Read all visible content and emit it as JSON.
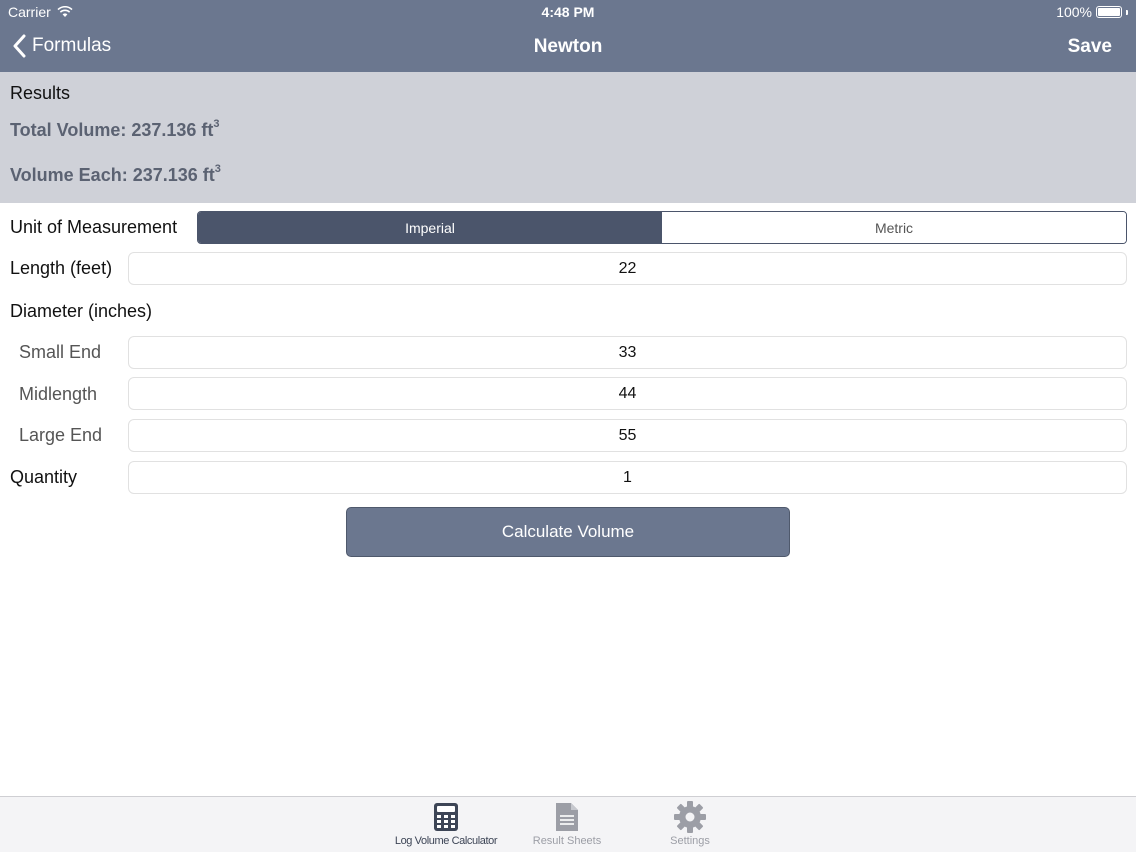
{
  "status_bar": {
    "carrier": "Carrier",
    "time": "4:48 PM",
    "battery": "100%"
  },
  "nav": {
    "back_label": "Formulas",
    "title": "Newton",
    "save_label": "Save"
  },
  "results": {
    "heading": "Results",
    "total_volume": "Total Volume: 237.136 ft",
    "volume_each": "Volume Each: 237.136 ft",
    "unit_exponent": "3"
  },
  "form": {
    "unit_label": "Unit of Measurement",
    "unit_options": [
      "Imperial",
      "Metric"
    ],
    "unit_selected": "Imperial",
    "length_label": "Length (feet)",
    "length_value": "22",
    "diameter_label": "Diameter (inches)",
    "small_end_label": "Small End",
    "small_end_value": "33",
    "midlength_label": "Midlength",
    "midlength_value": "44",
    "large_end_label": "Large End",
    "large_end_value": "55",
    "quantity_label": "Quantity",
    "quantity_value": "1",
    "calculate_label": "Calculate Volume"
  },
  "tabbar": {
    "tabs": [
      {
        "label": "Log Volume Calculator",
        "icon": "calculator-icon",
        "active": true
      },
      {
        "label": "Result Sheets",
        "icon": "document-icon",
        "active": false
      },
      {
        "label": "Settings",
        "icon": "gear-icon",
        "active": false
      }
    ]
  },
  "colors": {
    "nav_bar": "#6b778f",
    "results_bg": "#cfd1d8",
    "segment_active": "#4b556b",
    "button": "#6b778f",
    "tab_active": "#3d4556",
    "tab_inactive": "#9c9ea6"
  }
}
